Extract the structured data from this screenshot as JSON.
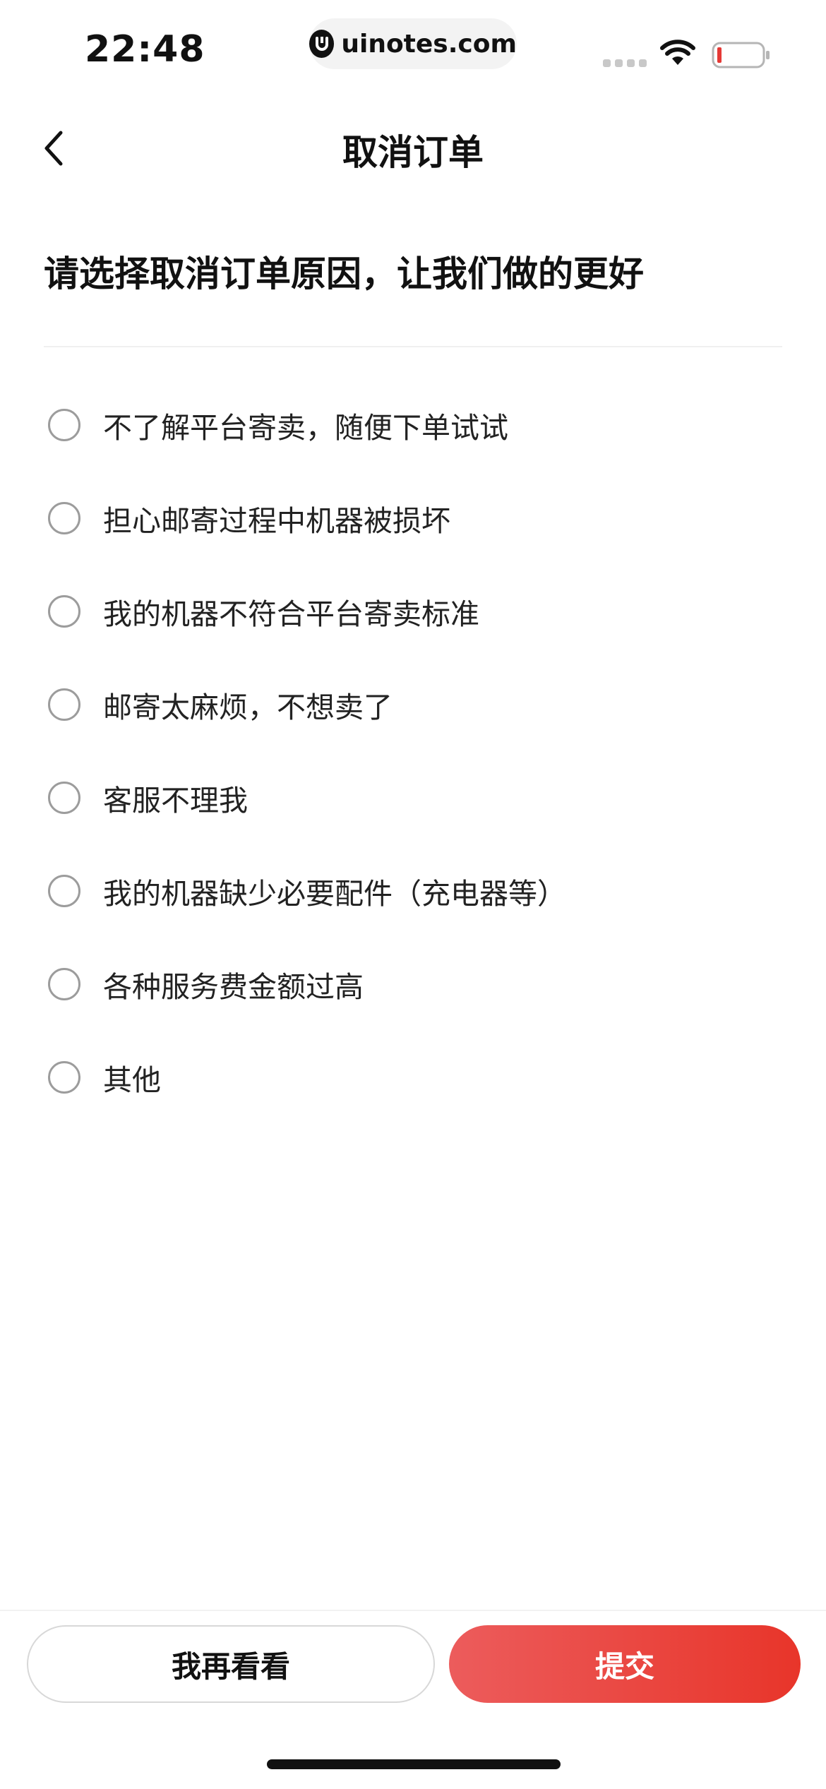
{
  "status_bar": {
    "time": "22:48",
    "url": "uinotes.com",
    "battery_color": "#e53935"
  },
  "nav": {
    "title": "取消订单"
  },
  "prompt": "请选择取消订单原因，让我们做的更好",
  "reasons": [
    {
      "label": "不了解平台寄卖，随便下单试试"
    },
    {
      "label": "担心邮寄过程中机器被损坏"
    },
    {
      "label": "我的机器不符合平台寄卖标准"
    },
    {
      "label": "邮寄太麻烦，不想卖了"
    },
    {
      "label": "客服不理我"
    },
    {
      "label": "我的机器缺少必要配件（充电器等）"
    },
    {
      "label": "各种服务费金额过高"
    },
    {
      "label": "其他"
    }
  ],
  "actions": {
    "secondary_label": "我再看看",
    "primary_label": "提交"
  },
  "colors": {
    "accent": "#e8352a",
    "accent_light": "#ec5c5c"
  }
}
